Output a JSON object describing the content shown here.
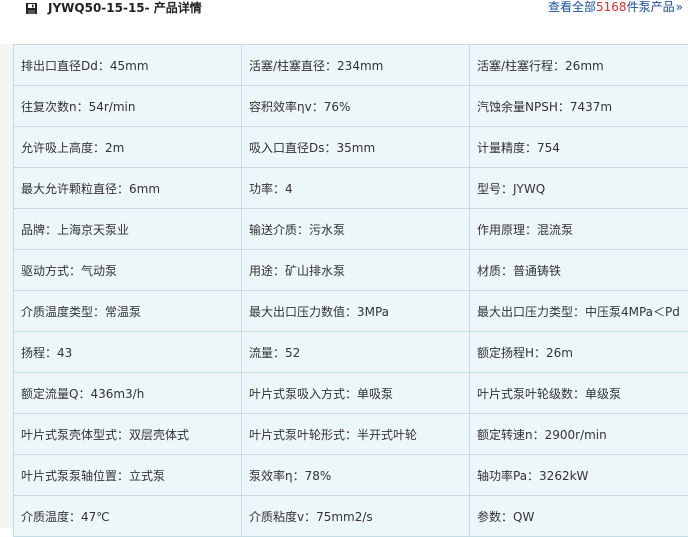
{
  "header": {
    "title": "JYWQ50-15-15- 产品详情",
    "link_prefix": "查看全部",
    "link_count": "5168",
    "link_suffix": "件泵产品",
    "link_arrows": "»"
  },
  "icons": {
    "title_icon": "floppy-disk-icon"
  },
  "colors": {
    "cell_bg": "#edf7fa",
    "cell_border": "#c3dbe3",
    "link": "#1a4fa0",
    "count": "#e0302a"
  },
  "specs": [
    [
      "排出口直径Dd：45mm",
      "活塞/柱塞直径：234mm",
      "活塞/柱塞行程：26mm"
    ],
    [
      "往复次数n：54r/min",
      "容积效率ηv：76%",
      "汽蚀余量NPSH：7437m"
    ],
    [
      "允许吸上高度：2m",
      "吸入口直径Ds：35mm",
      "计量精度：754"
    ],
    [
      "最大允许颗粒直径：6mm",
      "功率：4",
      "型号：JYWQ"
    ],
    [
      "品牌：上海京天泵业",
      "输送介质：污水泵",
      "作用原理：混流泵"
    ],
    [
      "驱动方式：气动泵",
      "用途：矿山排水泵",
      "材质：普通铸铁"
    ],
    [
      "介质温度类型：常温泵",
      "最大出口压力数值：3MPa",
      "最大出口压力类型：中压泵4MPa＜Pd"
    ],
    [
      "扬程：43",
      "流量：52",
      "额定扬程H：26m"
    ],
    [
      "额定流量Q：436m3/h",
      "叶片式泵吸入方式：单吸泵",
      "叶片式泵叶轮级数：单级泵"
    ],
    [
      "叶片式泵壳体型式：双层壳体式",
      "叶片式泵叶轮形式：半开式叶轮",
      "额定转速n：2900r/min"
    ],
    [
      "叶片式泵泵轴位置：立式泵",
      "泵效率η：78%",
      "轴功率Pa：3262kW"
    ],
    [
      "介质温度：47℃",
      "介质粘度v：75mm2/s",
      "参数：QW"
    ]
  ]
}
